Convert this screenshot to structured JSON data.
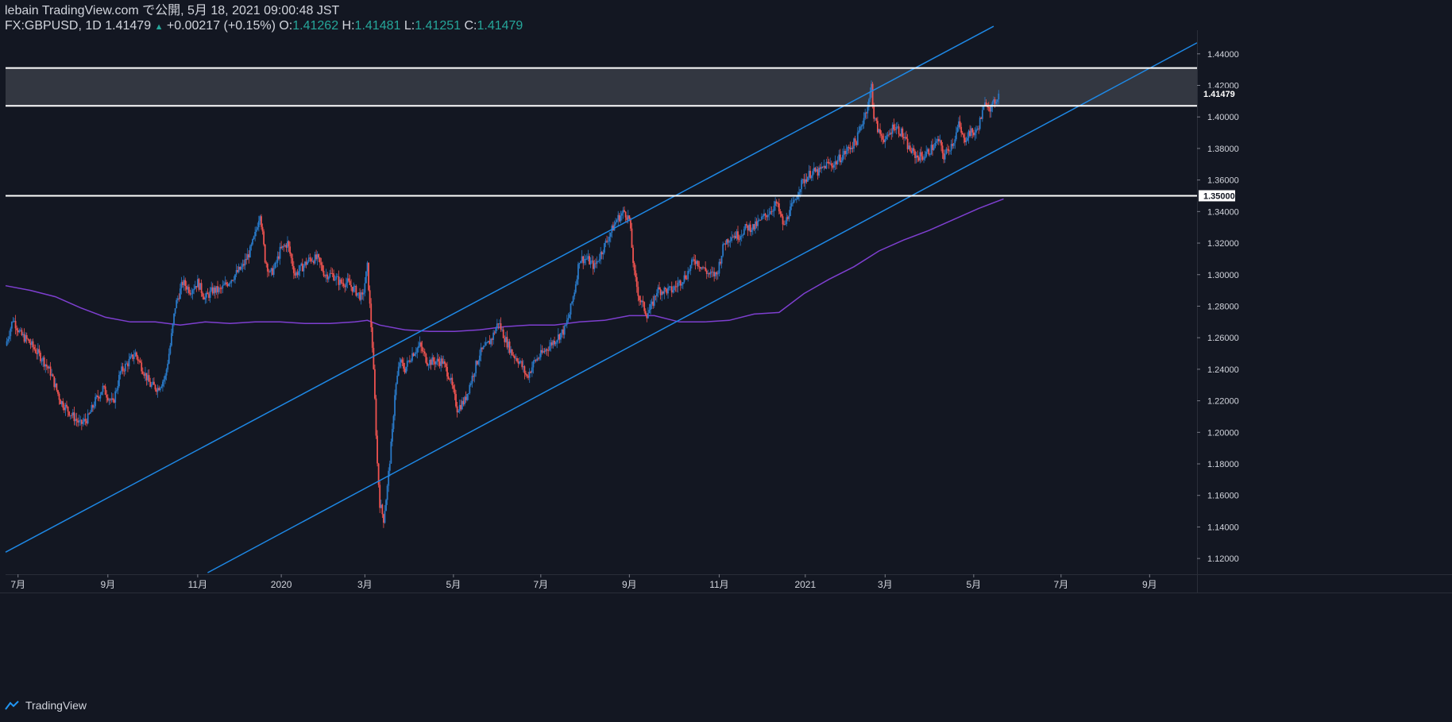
{
  "header": {
    "publish": "lebain TradingView.com で公開, 5月 18, 2021 09:00:48 JST",
    "symbol": "FX:GBPUSD, 1D",
    "last": "1.41479",
    "change_arrow": "▲",
    "change": "+0.00217 (+0.15%)",
    "o_label": "O:",
    "o": "1.41262",
    "h_label": "H:",
    "h": "1.41481",
    "l_label": "L:",
    "l": "1.41251",
    "c_label": "C:",
    "c": "1.41479"
  },
  "footer": {
    "brand": "TradingView"
  },
  "colors": {
    "background": "#131722",
    "up": "#2979c7",
    "down": "#ef5350",
    "channel": "#1e88e5",
    "ma": "#7e3fd0",
    "zone": "#3a3d46",
    "level": "#ffffff",
    "grid": "#2a2e39",
    "text": "#d1d4dc",
    "accent": "#26a69a"
  },
  "chart_data": {
    "type": "candlestick",
    "ylim": [
      1.11,
      1.455
    ],
    "y_ticks": [
      "1.44000",
      "1.42000",
      "1.40000",
      "1.38000",
      "1.36000",
      "1.34000",
      "1.32000",
      "1.30000",
      "1.28000",
      "1.26000",
      "1.24000",
      "1.22000",
      "1.20000",
      "1.18000",
      "1.16000",
      "1.14000",
      "1.12000"
    ],
    "x_ticks": [
      {
        "label": "7月",
        "t": 10
      },
      {
        "label": "9月",
        "t": 82
      },
      {
        "label": "11月",
        "t": 154
      },
      {
        "label": "2020",
        "t": 221
      },
      {
        "label": "3月",
        "t": 288
      },
      {
        "label": "5月",
        "t": 359
      },
      {
        "label": "7月",
        "t": 429
      },
      {
        "label": "9月",
        "t": 500
      },
      {
        "label": "11月",
        "t": 572
      },
      {
        "label": "2021",
        "t": 641
      },
      {
        "label": "3月",
        "t": 705
      },
      {
        "label": "5月",
        "t": 776
      },
      {
        "label": "7月",
        "t": 846
      },
      {
        "label": "9月",
        "t": 917
      }
    ],
    "price_label": "1.41479",
    "level_label": "1.35000",
    "zone": [
      1.407,
      1.431
    ],
    "levels": [
      1.431,
      1.407,
      1.35
    ],
    "price_path": [
      [
        0,
        1.255
      ],
      [
        6,
        1.272
      ],
      [
        12,
        1.262
      ],
      [
        18,
        1.258
      ],
      [
        24,
        1.252
      ],
      [
        30,
        1.246
      ],
      [
        36,
        1.238
      ],
      [
        44,
        1.22
      ],
      [
        52,
        1.212
      ],
      [
        60,
        1.205
      ],
      [
        66,
        1.209
      ],
      [
        72,
        1.22
      ],
      [
        78,
        1.228
      ],
      [
        86,
        1.218
      ],
      [
        92,
        1.238
      ],
      [
        98,
        1.244
      ],
      [
        104,
        1.25
      ],
      [
        110,
        1.24
      ],
      [
        116,
        1.23
      ],
      [
        122,
        1.228
      ],
      [
        128,
        1.235
      ],
      [
        132,
        1.255
      ],
      [
        136,
        1.28
      ],
      [
        142,
        1.295
      ],
      [
        148,
        1.29
      ],
      [
        154,
        1.295
      ],
      [
        160,
        1.285
      ],
      [
        166,
        1.29
      ],
      [
        172,
        1.29
      ],
      [
        178,
        1.295
      ],
      [
        184,
        1.3
      ],
      [
        190,
        1.305
      ],
      [
        196,
        1.315
      ],
      [
        200,
        1.325
      ],
      [
        204,
        1.34
      ],
      [
        208,
        1.31
      ],
      [
        212,
        1.3
      ],
      [
        216,
        1.305
      ],
      [
        220,
        1.315
      ],
      [
        226,
        1.32
      ],
      [
        232,
        1.3
      ],
      [
        238,
        1.305
      ],
      [
        244,
        1.31
      ],
      [
        250,
        1.31
      ],
      [
        256,
        1.3
      ],
      [
        262,
        1.3
      ],
      [
        268,
        1.295
      ],
      [
        274,
        1.295
      ],
      [
        280,
        1.29
      ],
      [
        286,
        1.285
      ],
      [
        290,
        1.305
      ],
      [
        294,
        1.255
      ],
      [
        296,
        1.22
      ],
      [
        298,
        1.18
      ],
      [
        300,
        1.155
      ],
      [
        303,
        1.145
      ],
      [
        306,
        1.165
      ],
      [
        310,
        1.2
      ],
      [
        312,
        1.225
      ],
      [
        316,
        1.245
      ],
      [
        320,
        1.24
      ],
      [
        326,
        1.25
      ],
      [
        332,
        1.255
      ],
      [
        338,
        1.245
      ],
      [
        344,
        1.245
      ],
      [
        350,
        1.245
      ],
      [
        356,
        1.235
      ],
      [
        362,
        1.215
      ],
      [
        368,
        1.22
      ],
      [
        374,
        1.235
      ],
      [
        380,
        1.25
      ],
      [
        386,
        1.255
      ],
      [
        390,
        1.26
      ],
      [
        395,
        1.27
      ],
      [
        400,
        1.26
      ],
      [
        406,
        1.25
      ],
      [
        412,
        1.245
      ],
      [
        418,
        1.235
      ],
      [
        424,
        1.245
      ],
      [
        430,
        1.25
      ],
      [
        436,
        1.255
      ],
      [
        442,
        1.26
      ],
      [
        448,
        1.265
      ],
      [
        452,
        1.275
      ],
      [
        456,
        1.29
      ],
      [
        460,
        1.31
      ],
      [
        466,
        1.31
      ],
      [
        472,
        1.305
      ],
      [
        478,
        1.315
      ],
      [
        484,
        1.325
      ],
      [
        490,
        1.335
      ],
      [
        496,
        1.34
      ],
      [
        500,
        1.335
      ],
      [
        504,
        1.3
      ],
      [
        508,
        1.285
      ],
      [
        514,
        1.275
      ],
      [
        518,
        1.28
      ],
      [
        522,
        1.29
      ],
      [
        528,
        1.29
      ],
      [
        534,
        1.29
      ],
      [
        540,
        1.295
      ],
      [
        546,
        1.3
      ],
      [
        552,
        1.31
      ],
      [
        558,
        1.305
      ],
      [
        564,
        1.3
      ],
      [
        570,
        1.3
      ],
      [
        576,
        1.32
      ],
      [
        582,
        1.325
      ],
      [
        588,
        1.325
      ],
      [
        594,
        1.33
      ],
      [
        600,
        1.33
      ],
      [
        606,
        1.335
      ],
      [
        612,
        1.34
      ],
      [
        618,
        1.345
      ],
      [
        624,
        1.33
      ],
      [
        628,
        1.34
      ],
      [
        632,
        1.345
      ],
      [
        636,
        1.355
      ],
      [
        640,
        1.36
      ],
      [
        646,
        1.365
      ],
      [
        652,
        1.365
      ],
      [
        658,
        1.37
      ],
      [
        664,
        1.37
      ],
      [
        670,
        1.375
      ],
      [
        676,
        1.38
      ],
      [
        682,
        1.385
      ],
      [
        688,
        1.4
      ],
      [
        692,
        1.41
      ],
      [
        694,
        1.42
      ],
      [
        696,
        1.4
      ],
      [
        700,
        1.39
      ],
      [
        706,
        1.385
      ],
      [
        712,
        1.395
      ],
      [
        718,
        1.39
      ],
      [
        724,
        1.38
      ],
      [
        730,
        1.375
      ],
      [
        736,
        1.375
      ],
      [
        742,
        1.38
      ],
      [
        748,
        1.385
      ],
      [
        752,
        1.375
      ],
      [
        756,
        1.38
      ],
      [
        760,
        1.385
      ],
      [
        764,
        1.395
      ],
      [
        768,
        1.385
      ],
      [
        772,
        1.39
      ],
      [
        778,
        1.39
      ],
      [
        782,
        1.4
      ],
      [
        786,
        1.41
      ],
      [
        790,
        1.405
      ],
      [
        793,
        1.41
      ],
      [
        796,
        1.41479
      ]
    ],
    "ma_path": [
      [
        0,
        1.293
      ],
      [
        20,
        1.29
      ],
      [
        40,
        1.286
      ],
      [
        60,
        1.279
      ],
      [
        80,
        1.273
      ],
      [
        100,
        1.27
      ],
      [
        120,
        1.27
      ],
      [
        140,
        1.268
      ],
      [
        160,
        1.27
      ],
      [
        180,
        1.269
      ],
      [
        200,
        1.27
      ],
      [
        220,
        1.27
      ],
      [
        240,
        1.269
      ],
      [
        260,
        1.269
      ],
      [
        280,
        1.27
      ],
      [
        290,
        1.271
      ],
      [
        300,
        1.268
      ],
      [
        320,
        1.265
      ],
      [
        340,
        1.264
      ],
      [
        360,
        1.264
      ],
      [
        380,
        1.265
      ],
      [
        400,
        1.267
      ],
      [
        420,
        1.268
      ],
      [
        440,
        1.268
      ],
      [
        460,
        1.27
      ],
      [
        480,
        1.271
      ],
      [
        500,
        1.274
      ],
      [
        520,
        1.274
      ],
      [
        540,
        1.27
      ],
      [
        560,
        1.27
      ],
      [
        580,
        1.271
      ],
      [
        600,
        1.275
      ],
      [
        620,
        1.276
      ],
      [
        640,
        1.288
      ],
      [
        660,
        1.297
      ],
      [
        680,
        1.305
      ],
      [
        700,
        1.315
      ],
      [
        720,
        1.322
      ],
      [
        740,
        1.328
      ],
      [
        760,
        1.335
      ],
      [
        780,
        1.342
      ],
      [
        800,
        1.348
      ]
    ],
    "channel_upper": [
      [
        0,
        1.124
      ],
      [
        792,
        1.4575
      ]
    ],
    "channel_lower": [
      [
        162,
        1.111
      ],
      [
        955,
        1.447
      ]
    ],
    "x_max": 955
  }
}
